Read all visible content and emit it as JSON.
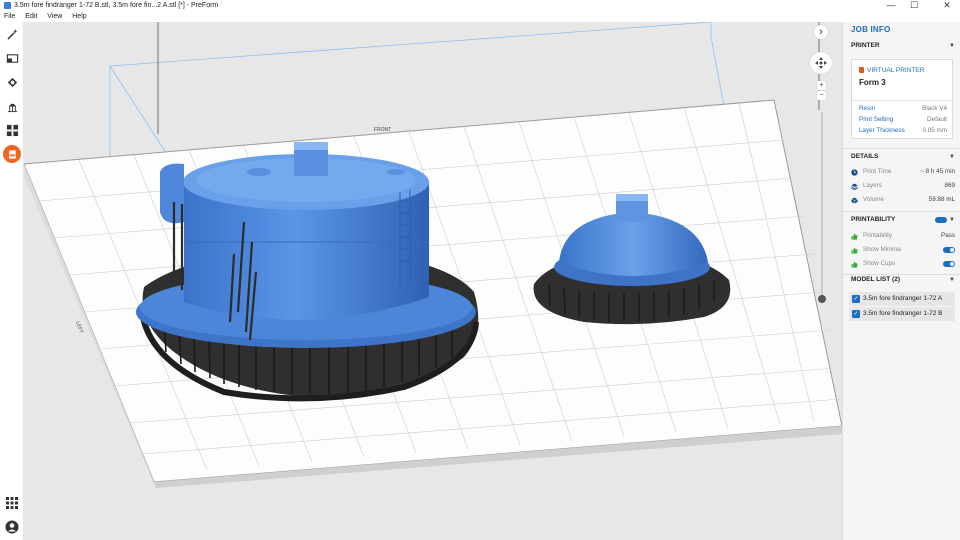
{
  "window": {
    "title": "3.5m fore findranger 1-72 B.stl, 3.5m fore fin...2 A.stl [*] - PreForm",
    "minimize": "—",
    "maximize": "☐",
    "close": "✕"
  },
  "menu": [
    "File",
    "Edit",
    "View",
    "Help"
  ],
  "toolbar": {
    "tools": [
      "magic-wand-icon",
      "scale-icon",
      "orient-icon",
      "supports-icon",
      "layout-icon",
      "print-icon"
    ],
    "bottom": [
      "apps-grid-icon",
      "account-icon"
    ]
  },
  "viewport": {
    "nav_next": "›",
    "zoom_in": "+",
    "zoom_out": "−",
    "plate_label_front": "FRONT",
    "plate_label_left": "LEFT",
    "model_color": "#4a86dc",
    "support_color": "#2e2e2e"
  },
  "panel": {
    "title": "JOB INFO",
    "printer": {
      "header": "PRINTER",
      "virtual_label": "VIRTUAL PRINTER",
      "name": "Form 3",
      "resin_label": "Resin",
      "resin_value": "Black V4",
      "setting_label": "Print Setting",
      "setting_value": "Default",
      "thickness_label": "Layer Thickness",
      "thickness_value": "0.05 mm"
    },
    "details": {
      "header": "DETAILS",
      "print_time_label": "Print Time",
      "print_time_value": "~ 8 h 45 min",
      "layers_label": "Layers",
      "layers_value": "869",
      "volume_label": "Volume",
      "volume_value": "59.88 mL"
    },
    "printability": {
      "header": "PRINTABILITY",
      "printability_label": "Printability",
      "printability_value": "Pass",
      "minima_label": "Show Minima",
      "cups_label": "Show Cups"
    },
    "models": {
      "header": "MODEL LIST (2)",
      "items": [
        "3.5m fore findranger 1-72 A",
        "3.5m fore findranger 1-72 B"
      ]
    }
  },
  "colors": {
    "accent": "#1b6ec2",
    "active_tool": "#f26522",
    "pass_icon": "#3aa83a"
  }
}
